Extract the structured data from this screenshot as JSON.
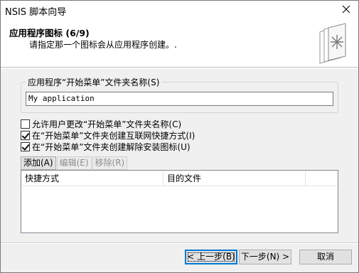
{
  "window": {
    "title": "NSIS 脚本向导"
  },
  "header": {
    "title": "应用程序图标 (6/9)",
    "subtitle": "请指定那一个图标会从应用程序创建。."
  },
  "folder_group": {
    "label": "应用程序“开始菜单”文件夹名称(S)",
    "value": "My application"
  },
  "options": [
    {
      "label": "允许用户更改“开始菜单”文件夹名称(C)",
      "checked": false
    },
    {
      "label": "在“开始菜单”文件夹创建互联网快捷方式(I)",
      "checked": true
    },
    {
      "label": "在“开始菜单”文件夹创建解除安装图标(U)",
      "checked": true
    }
  ],
  "list_buttons": {
    "add": "添加(A)",
    "edit": "编辑(E)",
    "remove": "移除(R)"
  },
  "shortcut_list": {
    "columns": [
      "快捷方式",
      "目的文件"
    ]
  },
  "footer": {
    "back": "< 上一步(B)",
    "next": "下一步(N) >",
    "cancel": "取消"
  }
}
